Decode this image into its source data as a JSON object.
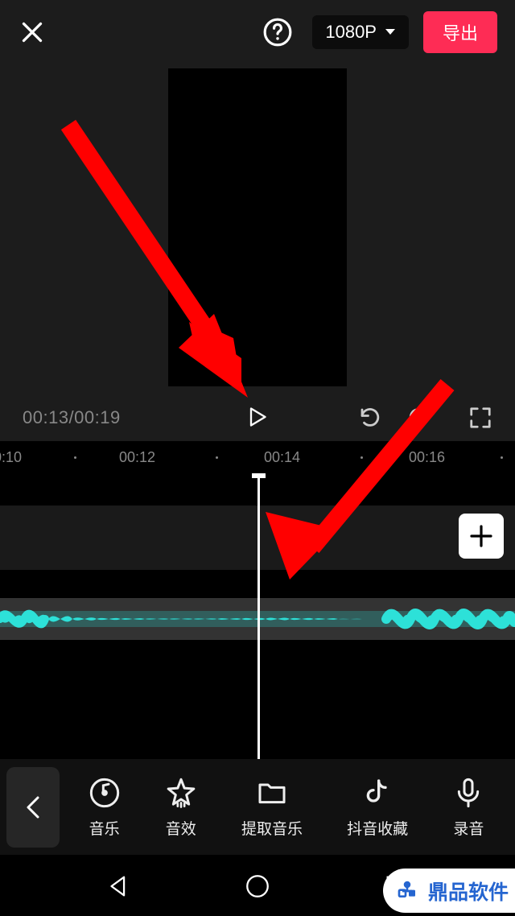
{
  "header": {
    "resolution_label": "1080P",
    "export_label": "导出"
  },
  "transport": {
    "timecode": "00:13/00:19"
  },
  "ruler": {
    "marks": [
      "0:10",
      "00:12",
      "00:14",
      "00:16"
    ]
  },
  "toolbar": {
    "items": [
      {
        "icon": "music-disc-icon",
        "label": "音乐"
      },
      {
        "icon": "star-icon",
        "label": "音效"
      },
      {
        "icon": "folder-icon",
        "label": "提取音乐"
      },
      {
        "icon": "douyin-icon",
        "label": "抖音收藏"
      },
      {
        "icon": "mic-icon",
        "label": "录音"
      }
    ]
  },
  "watermark": {
    "text": "鼎品软件"
  },
  "colors": {
    "accent": "#fe2c55",
    "waveform": "#2de1d8"
  }
}
